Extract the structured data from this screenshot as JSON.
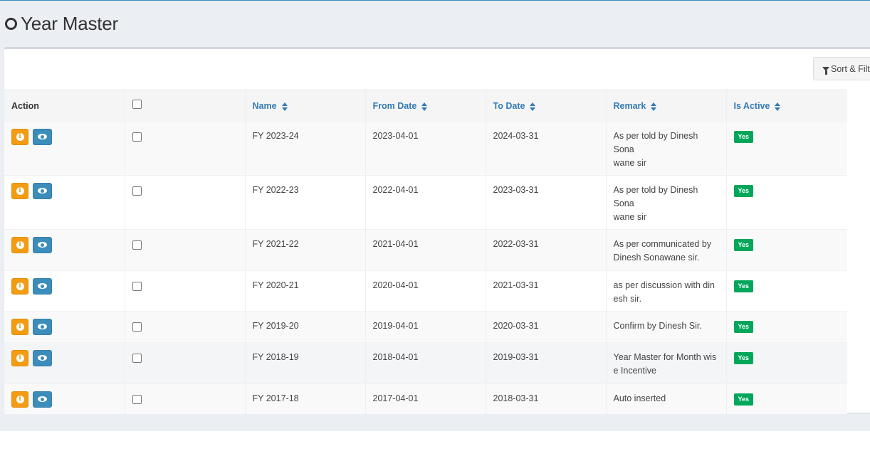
{
  "page": {
    "title": "Year Master",
    "title_icon": "circle-outline-icon"
  },
  "toolbar": {
    "sort_filter_label": "Sort & Filt",
    "sort_filter_icon": "filter-icon"
  },
  "table": {
    "columns": {
      "action": "Action",
      "name": "Name",
      "from_date": "From Date",
      "to_date": "To Date",
      "remark": "Remark",
      "is_active": "Is Active"
    },
    "rows": [
      {
        "name": "FY 2023-24",
        "from_date": "2023-04-01",
        "to_date": "2024-03-31",
        "remark_lines": [
          "As per told by Dinesh Sona",
          "wane sir"
        ],
        "is_active": "Yes"
      },
      {
        "name": "FY 2022-23",
        "from_date": "2022-04-01",
        "to_date": "2023-03-31",
        "remark_lines": [
          "As per told by Dinesh Sona",
          "wane sir"
        ],
        "is_active": "Yes"
      },
      {
        "name": "FY 2021-22",
        "from_date": "2021-04-01",
        "to_date": "2022-03-31",
        "remark_lines": [
          "As per communicated by",
          "Dinesh Sonawane sir."
        ],
        "is_active": "Yes"
      },
      {
        "name": "FY 2020-21",
        "from_date": "2020-04-01",
        "to_date": "2021-03-31",
        "remark_lines": [
          "as per discussion with din",
          "esh sir."
        ],
        "is_active": "Yes"
      },
      {
        "name": "FY 2019-20",
        "from_date": "2019-04-01",
        "to_date": "2020-03-31",
        "remark_lines": [
          "Confirm by Dinesh Sir."
        ],
        "is_active": "Yes"
      },
      {
        "name": "FY 2018-19",
        "from_date": "2018-04-01",
        "to_date": "2019-03-31",
        "remark_lines": [
          "Year Master for Month wis",
          "e Incentive"
        ],
        "is_active": "Yes"
      },
      {
        "name": "FY 2017-18",
        "from_date": "2017-04-01",
        "to_date": "2018-03-31",
        "remark_lines": [
          "Auto inserted"
        ],
        "is_active": "Yes"
      }
    ]
  },
  "colors": {
    "primary_link": "#337ab7",
    "warning": "#f39c12",
    "info": "#3c8dbc",
    "success": "#00a65a"
  }
}
